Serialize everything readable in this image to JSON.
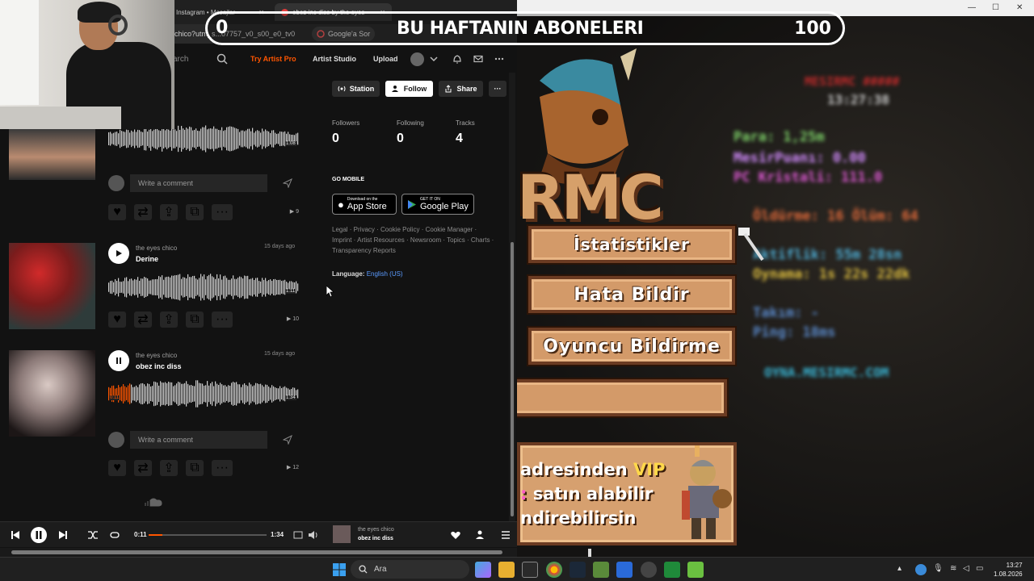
{
  "browser": {
    "tabs": [
      {
        "label": "Instagram • Mesajlar"
      },
      {
        "label": "obez inc diss by the eyes"
      }
    ],
    "url": "chico?utm_s...07757_v0_s00_e0_tv0",
    "google_sor": "Google'a Sor"
  },
  "soundcloud": {
    "header": {
      "search_placeholder": "arch",
      "try_pro": "Try Artist Pro",
      "artist_studio": "Artist Studio",
      "upload": "Upload"
    },
    "profile_actions": {
      "station": "Station",
      "follow": "Follow",
      "share": "Share",
      "more": "···"
    },
    "stats": [
      {
        "label": "Followers",
        "value": "0"
      },
      {
        "label": "Following",
        "value": "0"
      },
      {
        "label": "Tracks",
        "value": "4"
      }
    ],
    "go_mobile": "GO MOBILE",
    "app_store": {
      "small": "Download on the",
      "big": "App Store"
    },
    "google_play": {
      "small": "GET IT ON",
      "big": "Google Play"
    },
    "footer_links": "Legal · Privacy · Cookie Policy · Cookie Manager · Imprint · Artist Resources · Newsroom · Topics · Charts · Transparency Reports",
    "language_label": "Language:",
    "language_value": "English (US)",
    "comment_placeholder": "Write a comment",
    "tracks": [
      {
        "artist": "",
        "title": "",
        "ago": "",
        "duration": "1:08",
        "plays": "9",
        "playing": false
      },
      {
        "artist": "the eyes chico",
        "title": "Derine",
        "ago": "15 days ago",
        "duration": "1:11",
        "plays": "10",
        "playing": false
      },
      {
        "artist": "the eyes chico",
        "title": "obez inc diss",
        "ago": "15 days ago",
        "duration": "1:34",
        "elapsed": "0:11",
        "plays": "12",
        "playing": true,
        "progress": 0.117
      }
    ],
    "player": {
      "elapsed": "0:11",
      "duration": "1:34",
      "progress": 0.117,
      "now_artist": "the eyes chico",
      "now_title": "obez inc diss"
    }
  },
  "overlay": {
    "left_count": "0",
    "title": "BU HAFTANIN ABONELERI",
    "right_count": "100"
  },
  "game": {
    "buttons": [
      {
        "label": "İstatistikler"
      },
      {
        "label": "Hata Bildir"
      },
      {
        "label": "Oyuncu Bildirme"
      },
      {
        "label": ""
      }
    ],
    "logo_text": "RMC",
    "panel_lines": [
      {
        "pre": "adresinden ",
        "hl": "VIP",
        "post": ""
      },
      {
        "pre": "",
        "hl": ":",
        "post": " satın alabilir"
      },
      {
        "pre": "ndirebilirsin",
        "hl": "",
        "post": ""
      }
    ],
    "blurred_stats": [
      "MESIRMC #####",
      "13:27:38",
      "Para: 1,25m",
      "MesirPuanı: 0.00",
      "PC Kristali: 111.0",
      "Öldürme: 16   Ölüm: 64",
      "Aktiflik: 55m 28sn",
      "Oynama: 1s 22s 22dk",
      "Takım: -",
      "Ping: 18ms",
      "OYNA.MESIRMC.COM"
    ]
  },
  "taskbar": {
    "search": "Ara",
    "time": "13:27",
    "date": "1.08.2026"
  },
  "colors": {
    "soundcloud_orange": "#ff5500",
    "link_blue": "#5b9bff",
    "mc_button": "#d39a69"
  }
}
